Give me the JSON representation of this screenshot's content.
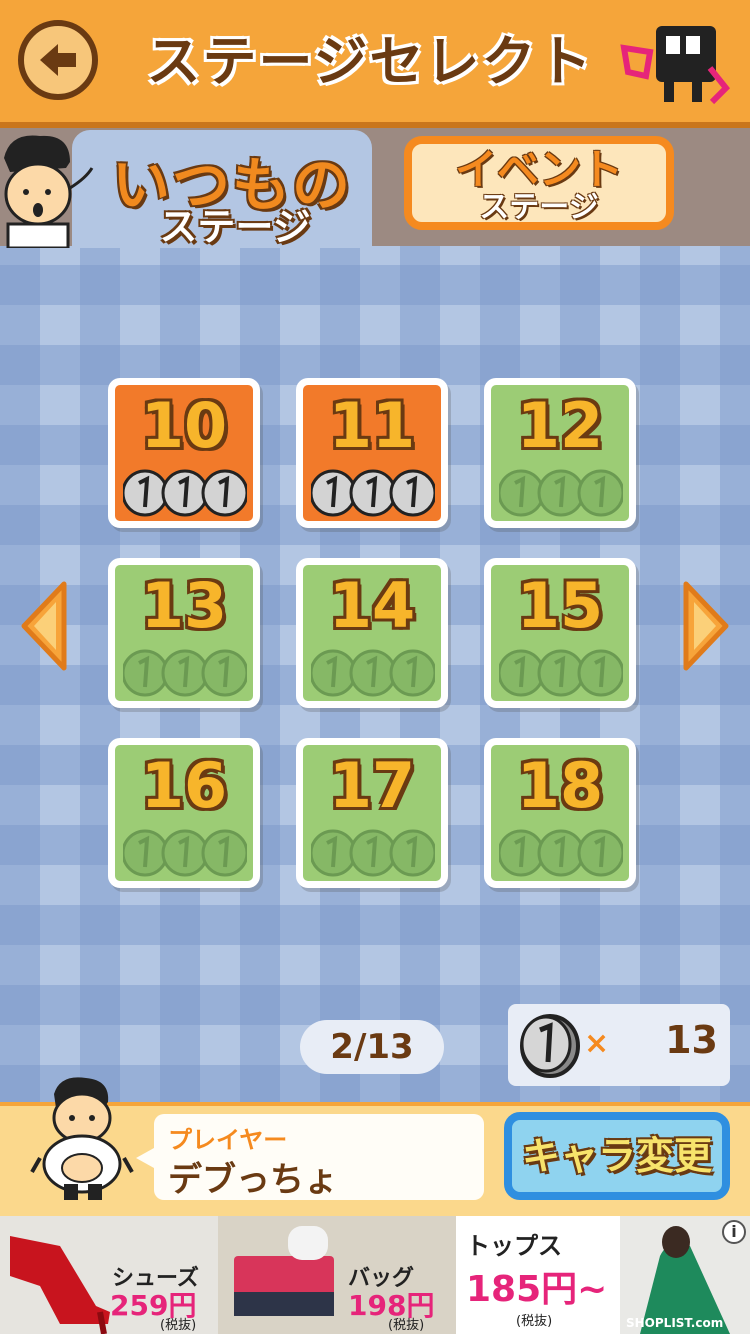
{
  "header": {
    "title": "ステージセレクト"
  },
  "tabs": [
    {
      "line1": "いつもの",
      "line2": "ステージ",
      "active": true
    },
    {
      "line1": "イベント",
      "line2": "ステージ",
      "active": false
    }
  ],
  "stages": [
    {
      "number": "10",
      "status": "cleared",
      "coins_collected": 3
    },
    {
      "number": "11",
      "status": "cleared",
      "coins_collected": 3
    },
    {
      "number": "12",
      "status": "locked",
      "coins_collected": 0
    },
    {
      "number": "13",
      "status": "locked",
      "coins_collected": 0
    },
    {
      "number": "14",
      "status": "locked",
      "coins_collected": 0
    },
    {
      "number": "15",
      "status": "locked",
      "coins_collected": 0
    },
    {
      "number": "16",
      "status": "locked",
      "coins_collected": 0
    },
    {
      "number": "17",
      "status": "locked",
      "coins_collected": 0
    },
    {
      "number": "18",
      "status": "locked",
      "coins_collected": 0
    }
  ],
  "progress": "2/13",
  "coins": {
    "multiplier": "×",
    "count": "13"
  },
  "player": {
    "label": "プレイヤー",
    "name": "デブっちょ"
  },
  "chara_button": "キャラ変更",
  "ad": {
    "items": [
      {
        "label": "シューズ",
        "price": "259円~",
        "tax": "(税抜)"
      },
      {
        "label": "バッグ",
        "price": "198円~",
        "tax": "(税抜)"
      },
      {
        "label": "トップス",
        "price": "185円~",
        "tax": "(税抜)"
      }
    ],
    "brand": "SHOPLIST.com",
    "info": "i"
  },
  "colors": {
    "header": "#f5a53a",
    "brown": "#6a3a12",
    "cleared": "#f27a2a",
    "locked": "#9ccc75",
    "button_blue": "#2f8fe0"
  }
}
